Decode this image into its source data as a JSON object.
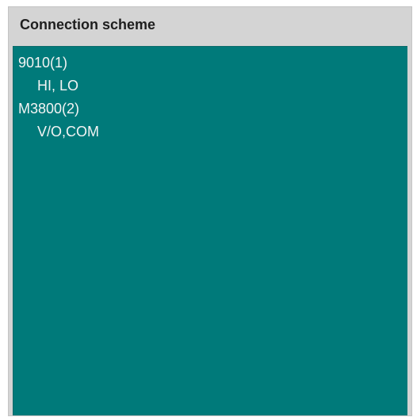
{
  "panel": {
    "title": "Connection scheme"
  },
  "tree": {
    "items": [
      {
        "label": "9010(1)",
        "level": 0
      },
      {
        "label": "HI, LO",
        "level": 1
      },
      {
        "label": "M3800(2)",
        "level": 0
      },
      {
        "label": "V/O,COM",
        "level": 1
      }
    ]
  },
  "colors": {
    "header_bg": "#d4d4d4",
    "list_bg": "#007a7a",
    "list_text": "#f4f4f4"
  }
}
